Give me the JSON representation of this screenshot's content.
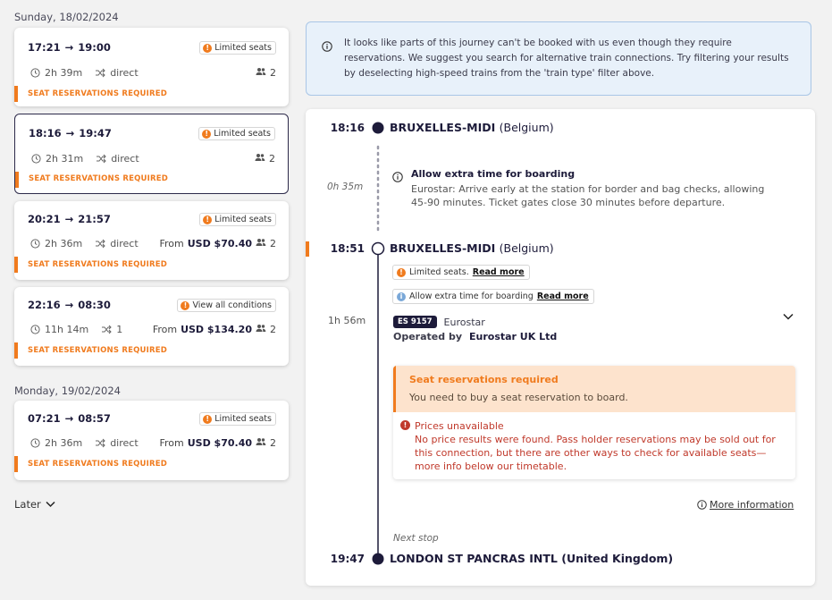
{
  "days": [
    {
      "date": "Sunday, 18/02/2024"
    },
    {
      "date": "Monday, 19/02/2024"
    }
  ],
  "cards": [
    {
      "depart": "17:21",
      "arrive": "19:00",
      "badge": "Limited seats",
      "badge_type": "orange",
      "duration": "2h 39m",
      "changes": "direct",
      "price_prefix": "",
      "price": "",
      "passengers": "2",
      "warning": "SEAT RESERVATIONS REQUIRED"
    },
    {
      "depart": "18:16",
      "arrive": "19:47",
      "badge": "Limited seats",
      "badge_type": "orange",
      "duration": "2h 31m",
      "changes": "direct",
      "price_prefix": "",
      "price": "",
      "passengers": "2",
      "warning": "SEAT RESERVATIONS REQUIRED"
    },
    {
      "depart": "20:21",
      "arrive": "21:57",
      "badge": "Limited seats",
      "badge_type": "orange",
      "duration": "2h 36m",
      "changes": "direct",
      "price_prefix": "From",
      "price": "USD $70.40",
      "passengers": "2",
      "warning": "SEAT RESERVATIONS REQUIRED"
    },
    {
      "depart": "22:16",
      "arrive": "08:30",
      "badge": "View all conditions",
      "badge_type": "orange",
      "duration": "11h 14m",
      "changes": "1",
      "price_prefix": "From",
      "price": "USD $134.20",
      "passengers": "2",
      "warning": "SEAT RESERVATIONS REQUIRED"
    },
    {
      "depart": "07:21",
      "arrive": "08:57",
      "badge": "Limited seats",
      "badge_type": "orange",
      "duration": "2h 36m",
      "changes": "direct",
      "price_prefix": "From",
      "price": "USD $70.40",
      "passengers": "2",
      "warning": "SEAT RESERVATIONS REQUIRED"
    }
  ],
  "later_label": "Later",
  "notice": "It looks like parts of this journey can't be booked with us even though they require reservations. We suggest you search for alternative train connections. Try filtering your results by deselecting high-speed trains from the 'train type' filter above.",
  "detail": {
    "stop1_time": "18:16",
    "stop1_name": "BRUXELLES-MIDI",
    "stop1_country": "(Belgium)",
    "transfer_duration": "0h 35m",
    "boarding_title": "Allow extra time for boarding",
    "boarding_text": "Eurostar: Arrive early at the station for border and bag checks, allowing 45-90 minutes. Ticket gates close 30 minutes before departure.",
    "stop2_time": "18:51",
    "stop2_name": "BRUXELLES-MIDI",
    "stop2_country": "(Belgium)",
    "tag1_text": "Limited seats.",
    "tag1_link": "Read more",
    "tag2_text": "Allow extra time for boarding",
    "tag2_link": "Read more",
    "leg_duration": "1h 56m",
    "train_number": "ES 9157",
    "operator_brand": "Eurostar",
    "operated_by_label": "Operated by",
    "operated_by": "Eurostar UK Ltd",
    "seat_title": "Seat reservations required",
    "seat_text": "You need to buy a seat reservation to board.",
    "price_err_title": "Prices unavailable",
    "price_err_text": "No price results were found. Pass holder reservations may be sold out for this connection, but there are other ways to check for available seats—more info below our timetable.",
    "more_info": "More information",
    "next_stop_label": "Next stop",
    "stop3_time": "19:47",
    "stop3_name": "LONDON ST PANCRAS INTL",
    "stop3_country": "(United Kingdom)"
  },
  "colors": {
    "accent": "#f07b1e",
    "navy": "#1d1b3a",
    "info_bg": "#e8f1fa",
    "error": "#c0392b"
  }
}
